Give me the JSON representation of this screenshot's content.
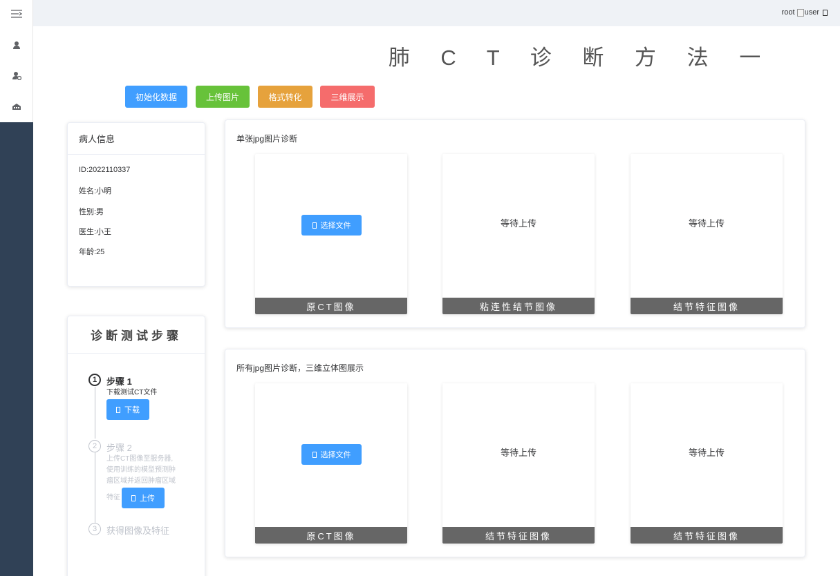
{
  "header": {
    "username": "root",
    "avatar_alt": "user"
  },
  "page_title": "肺 C T 诊 断 方 法 一",
  "toolbar": {
    "init_label": "初始化数据",
    "upload_label": "上传图片",
    "convert_label": "格式转化",
    "view3d_label": "三维展示"
  },
  "patient": {
    "title": "病人信息",
    "id": "ID:2022110337",
    "name": "姓名:小明",
    "gender": "性别:男",
    "doctor": "医生:小王",
    "age": "年龄:25"
  },
  "steps": {
    "title": "诊断测试步骤",
    "items": [
      {
        "num": "1",
        "title": "步骤 1",
        "desc": "下载测试CT文件",
        "button": "下载"
      },
      {
        "num": "2",
        "title": "步骤 2",
        "desc_lines": [
          "上传CT图像至服务器,",
          "使用训练的模型预测肿",
          "瘤区域并返回肿瘤区域",
          "特征"
        ],
        "button": "上传"
      },
      {
        "num": "3",
        "title": "获得图像及特征"
      }
    ]
  },
  "single": {
    "title": "单张jpg图片诊断",
    "select_label": "选择文件",
    "wait_label": "等待上传",
    "captions": [
      "原CT图像",
      "粘连性结节图像",
      "结节特征图像"
    ]
  },
  "all": {
    "title": "所有jpg图片诊断，三维立体图展示",
    "select_label": "选择文件",
    "wait_label": "等待上传",
    "captions": [
      "原CT图像",
      "结节特征图像",
      "结节特征图像"
    ]
  },
  "icons": {
    "menu": "menu-fold-icon",
    "user": "user-icon",
    "user_settings": "user-settings-icon",
    "building": "building-icon"
  }
}
